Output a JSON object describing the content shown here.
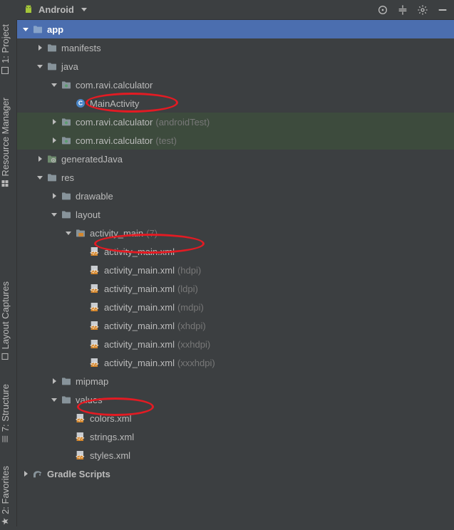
{
  "toolbar": {
    "mode_label": "Android"
  },
  "vtabs": {
    "project": "1: Project",
    "resource_manager": "Resource Manager",
    "layout_captures": "Layout Captures",
    "structure": "7: Structure",
    "favorites": "2: Favorites"
  },
  "tree": {
    "app": "app",
    "manifests": "manifests",
    "java": "java",
    "pkg_main": "com.ravi.calculator",
    "main_activity": "MainActivity",
    "pkg_android_test": "com.ravi.calculator",
    "pkg_android_test_suffix": "(androidTest)",
    "pkg_test": "com.ravi.calculator",
    "pkg_test_suffix": "(test)",
    "generated_java": "generatedJava",
    "res": "res",
    "drawable": "drawable",
    "layout": "layout",
    "activity_main_group": "activity_main",
    "activity_main_count": "(7)",
    "am_xml": "activity_main.xml",
    "am_hdpi": "activity_main.xml",
    "am_hdpi_suffix": "(hdpi)",
    "am_ldpi": "activity_main.xml",
    "am_ldpi_suffix": "(ldpi)",
    "am_mdpi": "activity_main.xml",
    "am_mdpi_suffix": "(mdpi)",
    "am_xhdpi": "activity_main.xml",
    "am_xhdpi_suffix": "(xhdpi)",
    "am_xxhdpi": "activity_main.xml",
    "am_xxhdpi_suffix": "(xxhdpi)",
    "am_xxxhdpi": "activity_main.xml",
    "am_xxxhdpi_suffix": "(xxxhdpi)",
    "mipmap": "mipmap",
    "values": "values",
    "colors_xml": "colors.xml",
    "strings_xml": "strings.xml",
    "styles_xml": "styles.xml",
    "gradle_scripts": "Gradle Scripts"
  }
}
